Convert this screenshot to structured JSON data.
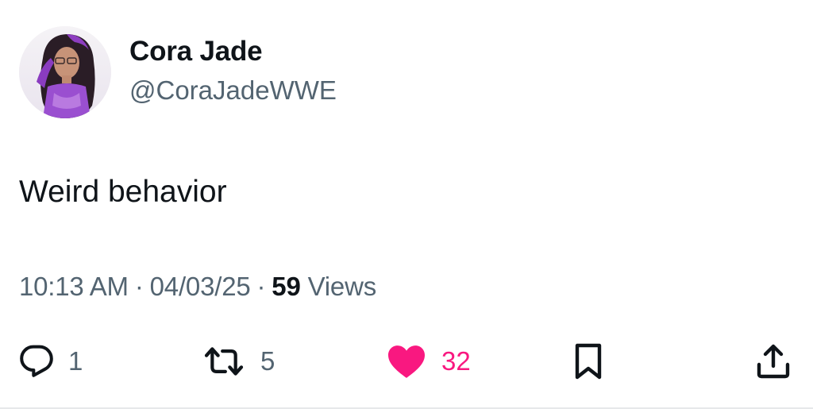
{
  "author": {
    "name": "Cora Jade",
    "handle": "@CoraJadeWWE"
  },
  "tweet": {
    "text": "Weird behavior"
  },
  "meta": {
    "time": "10:13 AM",
    "separator": "·",
    "date": "04/03/25",
    "views_count": "59",
    "views_label": "Views"
  },
  "actions": {
    "reply_count": "1",
    "retweet_count": "5",
    "like_count": "32"
  },
  "icons": {
    "reply": "reply-bubble-icon",
    "retweet": "retweet-arrows-icon",
    "like": "heart-filled-icon",
    "bookmark": "bookmark-icon",
    "share": "share-upload-icon"
  },
  "colors": {
    "text_primary": "#0f1419",
    "text_secondary": "#536471",
    "like_active": "#f91880"
  }
}
